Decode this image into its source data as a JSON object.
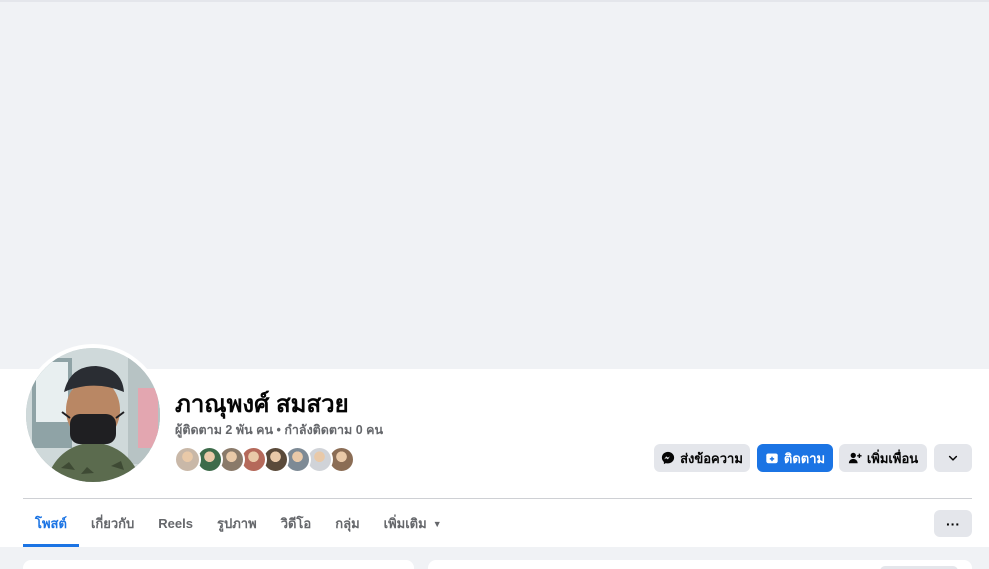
{
  "profile": {
    "name": "ภาณุพงศ์ สมสวย",
    "stats": "ผู้ติดตาม 2 พัน คน • กำลังติดตาม 0 คน",
    "friend_avatars": [
      {
        "icon": "friend-avatar-1",
        "color": "#c9b8a8"
      },
      {
        "icon": "friend-avatar-2",
        "color": "#3d6b4a"
      },
      {
        "icon": "friend-avatar-3",
        "color": "#8a7a6a"
      },
      {
        "icon": "friend-avatar-4",
        "color": "#b5695a"
      },
      {
        "icon": "friend-avatar-5",
        "color": "#5a4a3a"
      },
      {
        "icon": "friend-avatar-6",
        "color": "#7d8a95"
      },
      {
        "icon": "friend-avatar-7",
        "color": "#d0d3d8"
      },
      {
        "icon": "friend-avatar-8",
        "color": "#8b6d55"
      }
    ]
  },
  "actions": {
    "message_label": "ส่งข้อความ",
    "follow_label": "ติดตาม",
    "add_friend_label": "เพิ่มเพื่อน",
    "more_icon": "chevron-down-icon"
  },
  "tabs": [
    {
      "label": "โพสต์",
      "active": true
    },
    {
      "label": "เกี่ยวกับ",
      "active": false
    },
    {
      "label": "Reels",
      "active": false
    },
    {
      "label": "รูปภาพ",
      "active": false
    },
    {
      "label": "วิดีโอ",
      "active": false
    },
    {
      "label": "กลุ่ม",
      "active": false
    },
    {
      "label": "เพิ่มเติม",
      "active": false
    }
  ],
  "tabs_more_label": "···",
  "colors": {
    "accent": "#1b74e4",
    "background": "#f0f2f5",
    "button_gray": "#e4e6eb"
  }
}
